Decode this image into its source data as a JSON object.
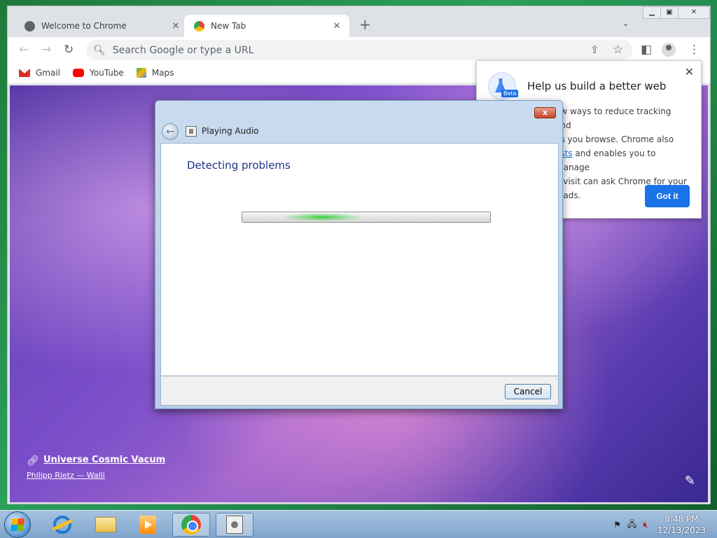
{
  "browser": {
    "tabs": [
      {
        "label": "Welcome to Chrome",
        "active": false
      },
      {
        "label": "New Tab",
        "active": true
      }
    ],
    "new_tab_symbol": "+",
    "omnibox_placeholder": "Search Google or type a URL",
    "bookmarks": [
      {
        "label": "Gmail",
        "icon": "gmail-icon",
        "color": "#d93025"
      },
      {
        "label": "YouTube",
        "icon": "youtube-icon",
        "color": "#ff0000"
      },
      {
        "label": "Maps",
        "icon": "maps-icon",
        "color": "#34a853"
      }
    ]
  },
  "background_credit": {
    "title": "Universe Cosmic Vacum",
    "author": "Philipp Rietz — Walli"
  },
  "popup": {
    "title": "Help us build a better web",
    "badge": "Beta",
    "body_line1": "ew ways to reduce tracking and",
    "body_line2": "as you browse. Chrome also",
    "body_link": "ests",
    "body_line3_rest": " and enables you to manage",
    "body_line4": "u visit can ask Chrome for your",
    "body_line5": "u ads.",
    "button": "Got it"
  },
  "dialog": {
    "title": "Playing Audio",
    "heading": "Detecting problems",
    "cancel": "Cancel",
    "close_symbol": "x"
  },
  "taskbar": {
    "time": "8:48 PM",
    "date": "12/13/2023"
  },
  "colors": {
    "accent": "#1a73e8",
    "dialog_heading": "#1e3287",
    "progress_glow": "#34d03a"
  }
}
